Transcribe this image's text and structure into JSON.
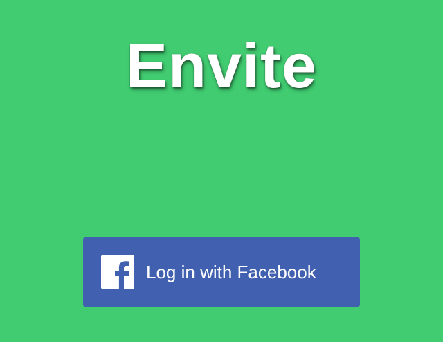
{
  "app": {
    "logo_text": "Envite",
    "background_color": "#41cc71"
  },
  "login": {
    "facebook_button_label": "Log in with Facebook",
    "facebook_button_color": "#4160b0",
    "icon": "facebook-icon"
  }
}
